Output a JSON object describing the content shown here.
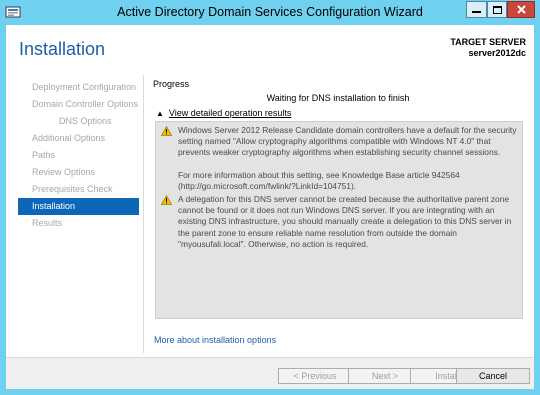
{
  "window": {
    "title": "Active Directory Domain Services Configuration Wizard",
    "controls": {
      "minimize": "minimize",
      "maximize": "maximize",
      "close": "close"
    }
  },
  "header": {
    "page_title": "Installation",
    "target_label": "TARGET SERVER",
    "target_name": "server2012dc"
  },
  "nav": {
    "items": [
      {
        "label": "Deployment Configuration"
      },
      {
        "label": "Domain Controller Options"
      },
      {
        "label": "DNS Options"
      },
      {
        "label": "Additional Options"
      },
      {
        "label": "Paths"
      },
      {
        "label": "Review Options"
      },
      {
        "label": "Prerequisites Check"
      },
      {
        "label": "Installation"
      },
      {
        "label": "Results"
      }
    ],
    "active_index": 7
  },
  "main": {
    "progress_label": "Progress",
    "status": "Waiting for DNS installation to finish",
    "details_toggle": "View detailed operation results",
    "messages": [
      {
        "icon": "warning-icon",
        "text": "Windows Server 2012 Release Candidate domain controllers have a default for the security setting named \"Allow cryptography algorithms compatible with Windows NT 4.0\" that prevents weaker cryptography algorithms when establishing security channel sessions.",
        "text2": "For more information about this setting, see Knowledge Base article 942564 (http://go.microsoft.com/fwlink/?LinkId=104751)."
      },
      {
        "icon": "warning-icon",
        "text": "A delegation for this DNS server cannot be created because the authoritative parent zone cannot be found or it does not run Windows DNS server. If you are integrating with an existing DNS infrastructure, you should manually create a delegation to this DNS server in the parent zone to ensure reliable name resolution from outside the domain \"myousufali.local\". Otherwise, no action is required."
      }
    ],
    "more_link": "More about installation options"
  },
  "footer": {
    "previous": "< Previous",
    "next": "Next >",
    "install": "Install",
    "cancel": "Cancel"
  },
  "colors": {
    "title_bar": "#6fd0f0",
    "accent_blue": "#1e5ea5",
    "nav_active": "#0d67b9",
    "close_button": "#c9483b",
    "warning_icon": "#f0c000"
  }
}
